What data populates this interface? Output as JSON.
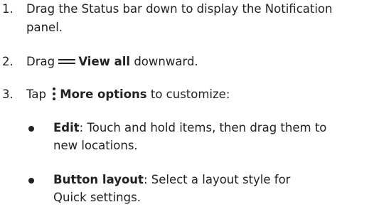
{
  "steps": [
    {
      "number": "1.",
      "line1": "Drag the Status bar down to display the Notification",
      "line2": "panel."
    },
    {
      "number": "2.",
      "pre": "Drag ",
      "icon": "drag-handle-icon",
      "bold": "View all",
      "post": " downward."
    },
    {
      "number": "3.",
      "pre": "Tap ",
      "icon": "more-options-icon",
      "bold": "More options",
      "post": " to customize:"
    }
  ],
  "bullets": [
    {
      "term": "Edit",
      "line1": ": Touch and hold items, then drag them to",
      "line2": "new locations."
    },
    {
      "term": "Button layout",
      "line1": ": Select a layout style for",
      "line2": "Quick settings."
    }
  ]
}
